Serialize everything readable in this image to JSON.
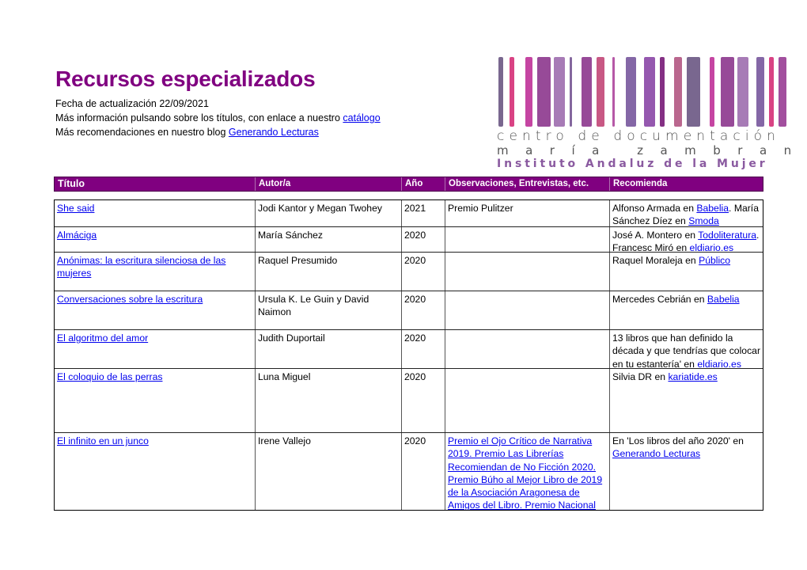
{
  "header": {
    "title": "Recursos especializados",
    "update_line": "Fecha de actualización 22/09/2021",
    "info_prefix": "Más información pulsando sobre los títulos, con enlace a nuestro ",
    "info_link": "catálogo",
    "blog_prefix": "Más recomendaciones en nuestro blog ",
    "blog_link": "Generando Lecturas"
  },
  "logo": {
    "line1": "centro de documentación",
    "line2": "maría zambrano",
    "line3": "Instituto Andaluz de la Mujer",
    "bar_colors": [
      "#6e5a86",
      "#d6337a",
      "#c0359a",
      "#8e3b8f",
      "#a070b0",
      "#7a5a96",
      "#8e3b8f",
      "#c34a7a",
      "#b04aa0",
      "#7a5a9e",
      "#8c4aa8",
      "#7a1e7a",
      "#b45a84",
      "#6e5a86",
      "#c0359a",
      "#8e3b8f",
      "#a070b0",
      "#7a5a9e",
      "#d6337a",
      "#9a4096"
    ],
    "accent": "#800080"
  },
  "table": {
    "columns": [
      "Título",
      "Autor/a",
      "Año",
      "Observaciones, Entrevistas, etc.",
      "Recomienda"
    ],
    "rows": [
      {
        "title": "She said",
        "author": "Jodi Kantor y Megan Twohey",
        "year": "2021",
        "observations": [
          {
            "text": "Premio Pulitzer",
            "link": false
          }
        ],
        "recommends": [
          {
            "text": "Alfonso Armada en ",
            "link": false
          },
          {
            "text": "Babelia",
            "link": true
          },
          {
            "text": ". María Sánchez Díez en ",
            "link": false
          },
          {
            "text": "Smoda ",
            "link": true
          }
        ]
      },
      {
        "title": "Almáciga",
        "author": "María Sánchez",
        "year": "2020",
        "observations": [],
        "recommends": [
          {
            "text": "José A. Montero en ",
            "link": false
          },
          {
            "text": "Todoliteratura",
            "link": true
          },
          {
            "text": ". Francesc Miró en",
            "link": false
          },
          {
            "text": " eldiario.es",
            "link": true
          }
        ]
      },
      {
        "title": "Anónimas: la escritura silenciosa de las mujeres",
        "author": "Raquel Presumido",
        "year": "2020",
        "observations": [],
        "recommends": [
          {
            "text": "Raquel Moraleja en ",
            "link": false
          },
          {
            "text": "Público",
            "link": true
          }
        ]
      },
      {
        "title": "Conversaciones sobre la escritura ",
        "author": "Ursula K. Le Guin y David Naimon",
        "year": "2020",
        "observations": [],
        "recommends": [
          {
            "text": "Mercedes Cebrián en ",
            "link": false
          },
          {
            "text": "Babelia",
            "link": true
          }
        ]
      },
      {
        "title": "El algoritmo del amor",
        "author": "Judith Duportail",
        "year": "2020",
        "observations": [],
        "recommends": [
          {
            "text": "13 libros que han definido la década y que tendrías que colocar en tu estantería' en ",
            "link": false
          },
          {
            "text": "eldiario.es ",
            "link": true
          }
        ]
      },
      {
        "title": "El coloquio de las perras",
        "author": "Luna Miguel",
        "year": "2020",
        "observations": [],
        "recommends": [
          {
            "text": "Silvia DR en ",
            "link": false
          },
          {
            "text": "kariatide.es",
            "link": true
          }
        ]
      },
      {
        "title": "El infinito en un junco",
        "author": "Irene  Vallejo",
        "year": "2020",
        "observations": [
          {
            "text": "Premio el Ojo Crítico de Narrativa 2019. Premio Las Librerías Recomiendan de No Ficción 2020. Premio Búho al Mejor Libro de 2019 de la Asociación Aragonesa de Amigos del Libro. Premio Nacional ",
            "link": true
          }
        ],
        "recommends": [
          {
            "text": "En 'Los libros del año 2020' en ",
            "link": false
          },
          {
            "text": "Generando Lecturas",
            "link": true
          }
        ]
      }
    ]
  }
}
